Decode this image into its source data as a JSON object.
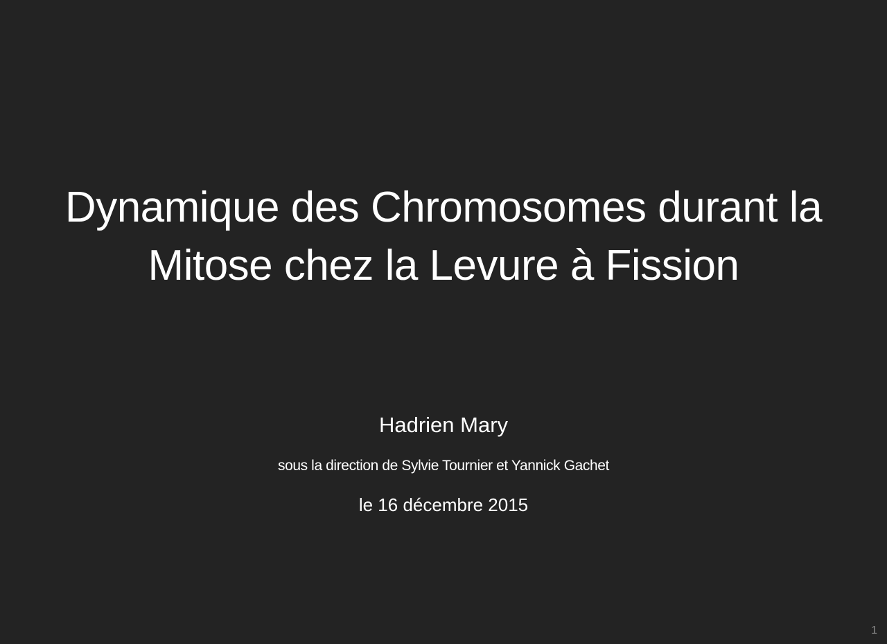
{
  "slide": {
    "title_lines": [
      "Dynamique des Chromosomes durant la",
      "Mitose chez la Levure à Fission"
    ],
    "author": "Hadrien Mary",
    "direction": "sous la direction de Sylvie Tournier et Yannick Gachet",
    "date": "le 16 décembre 2015",
    "page_number": "1"
  },
  "colors": {
    "background": "#232323",
    "text": "#ffffff",
    "page_number": "#8a8a8a"
  }
}
